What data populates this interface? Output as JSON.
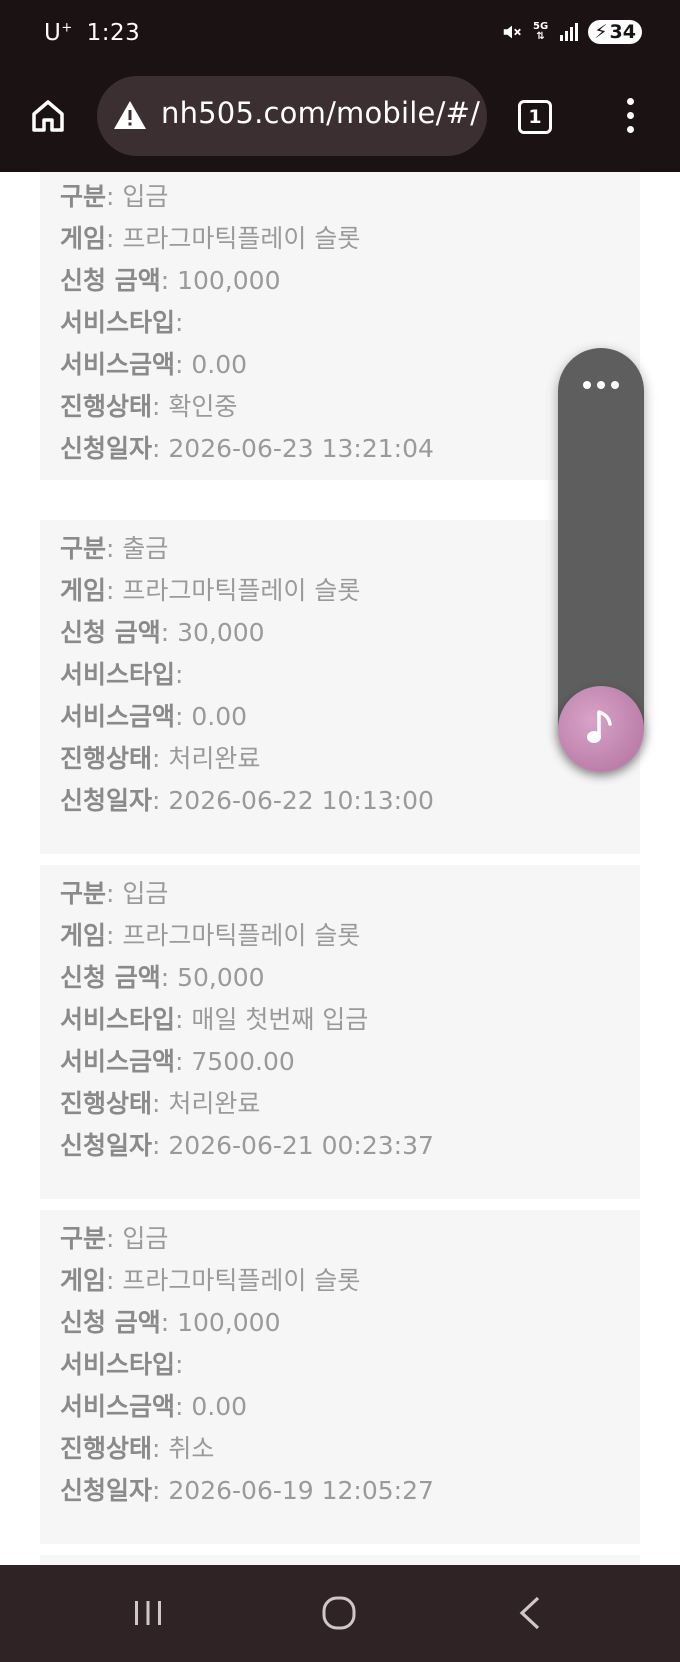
{
  "status_bar": {
    "carrier": "U",
    "carrier_sup": "+",
    "time": "1:23",
    "network": "5G",
    "battery": "34"
  },
  "browser": {
    "url": "nh505.com/mobile/#/",
    "tab_count": "1"
  },
  "records": [
    {
      "fields": [
        {
          "label": "구분",
          "value": "입금"
        },
        {
          "label": "게임",
          "value": "프라그마틱플레이 슬롯"
        },
        {
          "label": "신청 금액",
          "value": "100,000"
        },
        {
          "label": "서비스타입",
          "value": ""
        },
        {
          "label": "서비스금액",
          "value": "0.00"
        },
        {
          "label": "진행상태",
          "value": "확인중"
        },
        {
          "label": "신청일자",
          "value": "2026-06-23 13:21:04"
        }
      ]
    },
    {
      "fields": [
        {
          "label": "구분",
          "value": "출금"
        },
        {
          "label": "게임",
          "value": "프라그마틱플레이 슬롯"
        },
        {
          "label": "신청 금액",
          "value": "30,000"
        },
        {
          "label": "서비스타입",
          "value": ""
        },
        {
          "label": "서비스금액",
          "value": "0.00"
        },
        {
          "label": "진행상태",
          "value": "처리완료"
        },
        {
          "label": "신청일자",
          "value": "2026-06-22 10:13:00"
        }
      ]
    },
    {
      "fields": [
        {
          "label": "구분",
          "value": "입금"
        },
        {
          "label": "게임",
          "value": "프라그마틱플레이 슬롯"
        },
        {
          "label": "신청 금액",
          "value": "50,000"
        },
        {
          "label": "서비스타입",
          "value": "매일 첫번째 입금"
        },
        {
          "label": "서비스금액",
          "value": "7500.00"
        },
        {
          "label": "진행상태",
          "value": "처리완료"
        },
        {
          "label": "신청일자",
          "value": "2026-06-21 00:23:37"
        }
      ]
    },
    {
      "fields": [
        {
          "label": "구분",
          "value": "입금"
        },
        {
          "label": "게임",
          "value": "프라그마틱플레이 슬롯"
        },
        {
          "label": "신청 금액",
          "value": "100,000"
        },
        {
          "label": "서비스타입",
          "value": ""
        },
        {
          "label": "서비스금액",
          "value": "0.00"
        },
        {
          "label": "진행상태",
          "value": "취소"
        },
        {
          "label": "신청일자",
          "value": "2026-06-19 12:05:27"
        }
      ]
    }
  ],
  "icons": {
    "home": "home-icon",
    "warning": "warning-triangle-icon",
    "tabs": "tabs-icon",
    "menu": "more-vertical-icon",
    "float_more": "more-horizontal-icon",
    "music": "music-note-icon",
    "nav_recent": "recent-apps-icon",
    "nav_home": "nav-home-icon",
    "nav_back": "back-chevron-icon"
  }
}
